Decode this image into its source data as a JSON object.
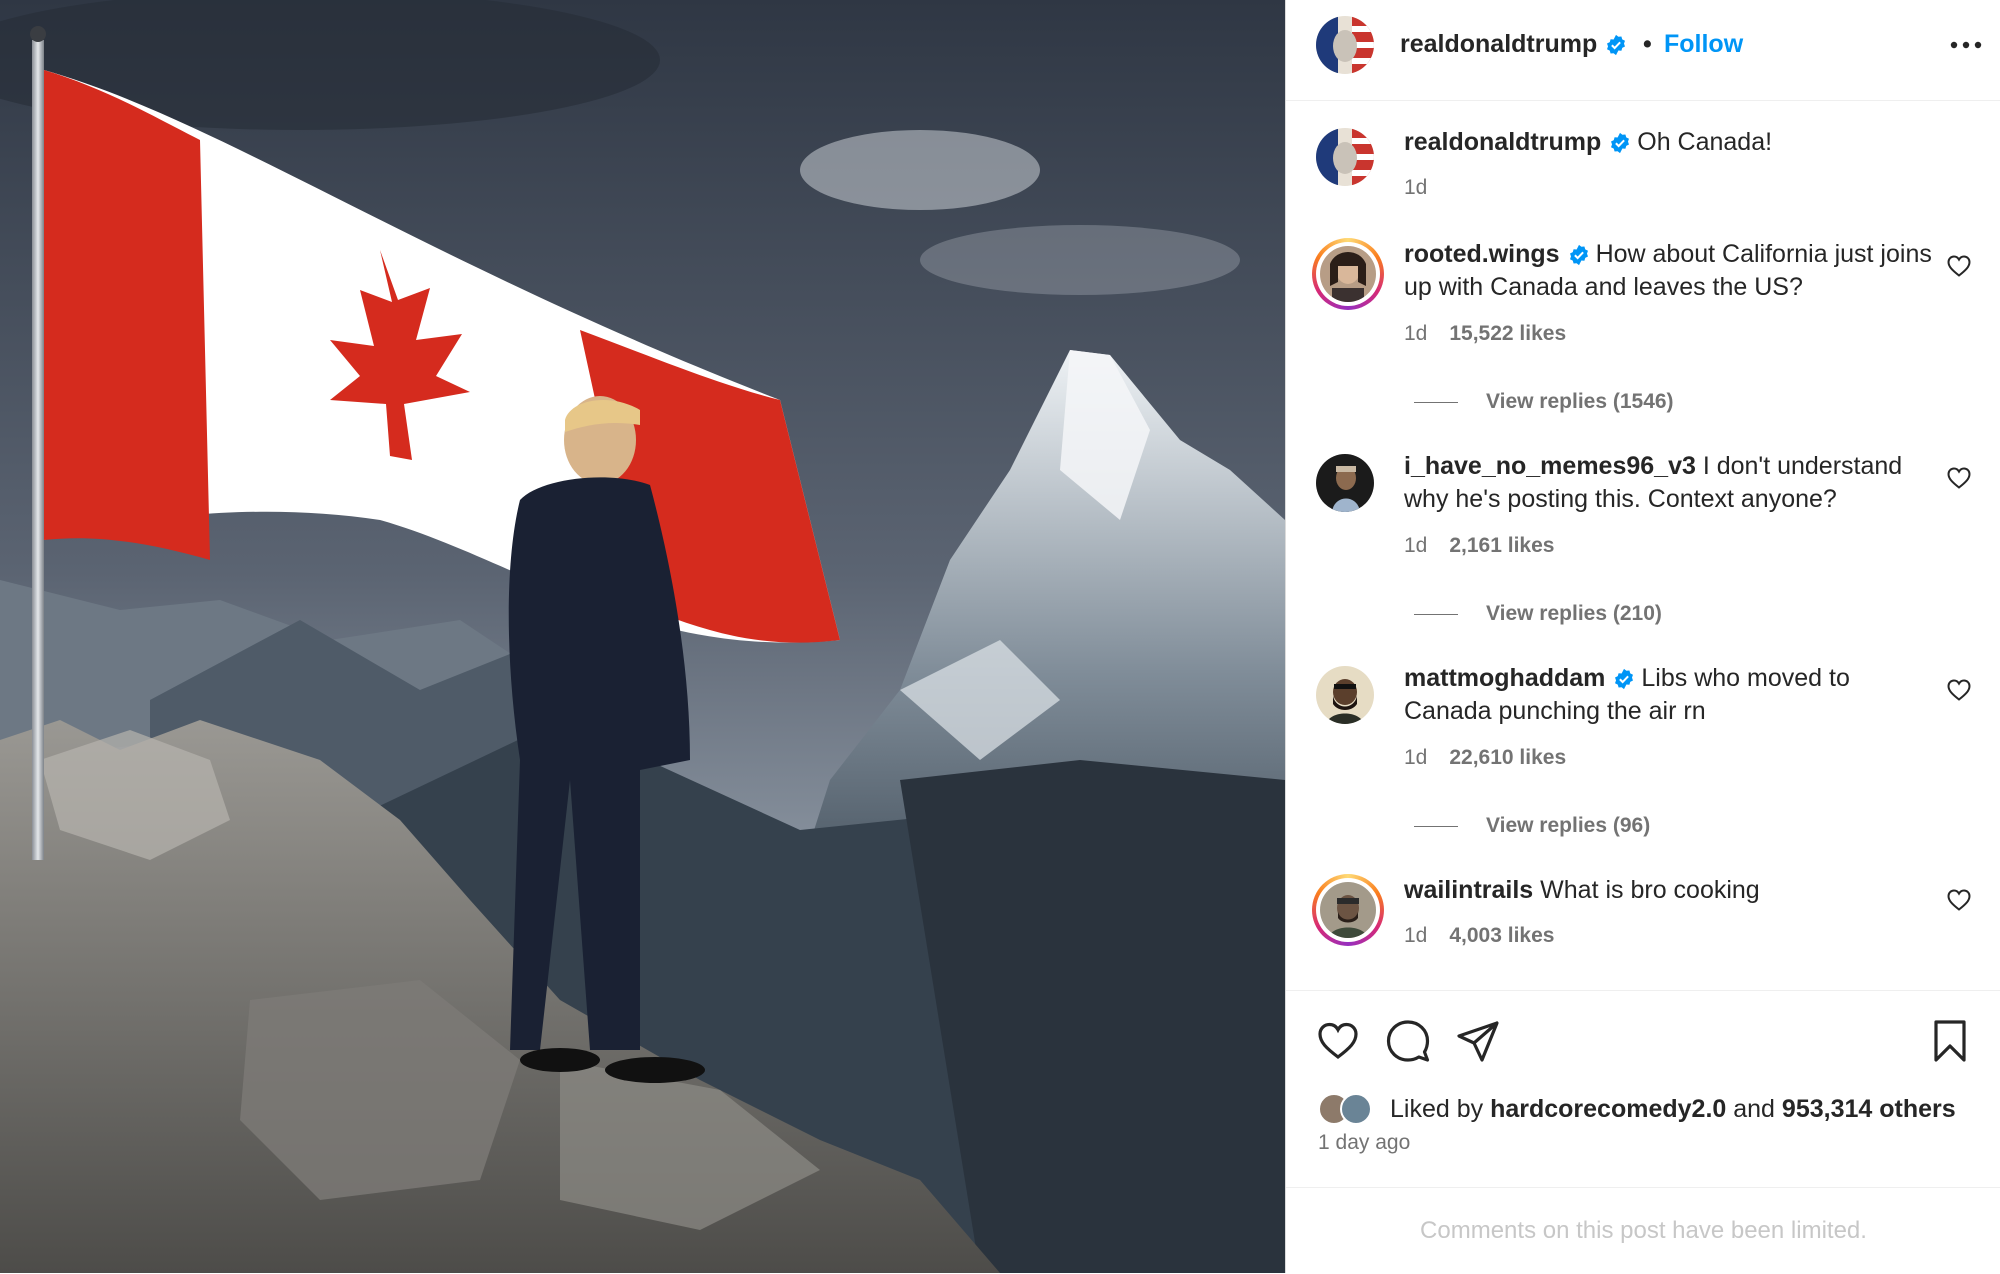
{
  "post": {
    "author": "realdonaldtrump",
    "follow_label": "Follow",
    "separator": "•",
    "caption": {
      "user": "realdonaldtrump",
      "text": "Oh Canada!",
      "time": "1d"
    }
  },
  "comments": [
    {
      "user": "rooted.wings",
      "verified": true,
      "text": "How about California just joins up with Canada and leaves the US?",
      "time": "1d",
      "likes": "15,522 likes",
      "replies": "View replies (1546)"
    },
    {
      "user": "i_have_no_memes96_v3",
      "verified": false,
      "text": "I don't understand why he's posting this. Context anyone?",
      "time": "1d",
      "likes": "2,161 likes",
      "replies": "View replies (210)"
    },
    {
      "user": "mattmoghaddam",
      "verified": true,
      "text": "Libs who moved to Canada punching the air rn",
      "time": "1d",
      "likes": "22,610 likes",
      "replies": "View replies (96)"
    },
    {
      "user": "wailintrails",
      "verified": false,
      "text": "What is bro cooking",
      "time": "1d",
      "likes": "4,003 likes"
    }
  ],
  "likes": {
    "prefix": "Liked by",
    "user": "hardcorecomedy2.0",
    "joiner": "and",
    "others": "953,314 others"
  },
  "time_ago": "1 day ago",
  "comments_limited": "Comments on this post have been limited.",
  "colors": {
    "accent": "#0095f6",
    "verified": "#0095f6",
    "flag_red": "#d52b1e"
  },
  "icons": [
    "verified-badge-icon",
    "more-options-icon",
    "heart-icon",
    "comment-icon",
    "share-icon",
    "bookmark-icon"
  ]
}
